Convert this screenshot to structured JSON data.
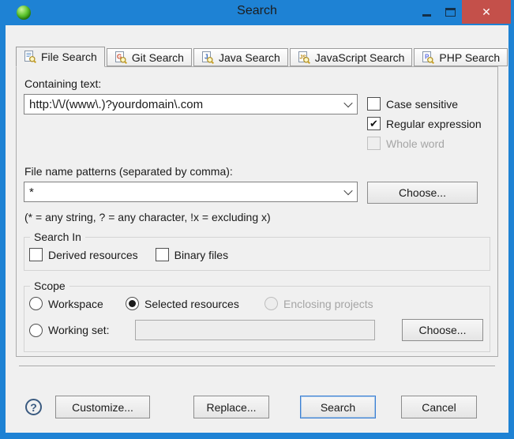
{
  "window": {
    "title": "Search",
    "icon": "app-icon-green-orb",
    "controls": {
      "minimize": "minimize-icon",
      "maximize": "maximize-icon",
      "close": "close-icon"
    }
  },
  "colors": {
    "titlebar_blue": "#1e82d4",
    "close_red": "#c4504a",
    "dialog_bg": "#f0f0f0",
    "default_button_border": "#3b7fd4"
  },
  "tabs": [
    {
      "label": "File Search",
      "glyph": "",
      "active": true
    },
    {
      "label": "Git Search",
      "glyph": "G",
      "active": false
    },
    {
      "label": "Java Search",
      "glyph": "J",
      "active": false
    },
    {
      "label": "JavaScript Search",
      "glyph": "JS",
      "active": false
    },
    {
      "label": "PHP Search",
      "glyph": "P",
      "active": false
    }
  ],
  "containing_text": {
    "label": "Containing text:",
    "value": "http:\\/\\/(www\\.)?yourdomain\\.com"
  },
  "options": {
    "case_sensitive": {
      "label": "Case sensitive",
      "checked": false,
      "enabled": true
    },
    "regular_expression": {
      "label": "Regular expression",
      "checked": true,
      "enabled": true
    },
    "whole_word": {
      "label": "Whole word",
      "checked": false,
      "enabled": false
    }
  },
  "file_patterns": {
    "label": "File name patterns (separated by comma):",
    "value": "*",
    "choose_label": "Choose...",
    "hint": "(* = any string, ? = any character, !x = excluding x)"
  },
  "search_in": {
    "legend": "Search In",
    "derived": {
      "label": "Derived resources",
      "checked": false
    },
    "binary": {
      "label": "Binary files",
      "checked": false
    }
  },
  "scope": {
    "legend": "Scope",
    "workspace": {
      "label": "Workspace",
      "selected": false,
      "enabled": true
    },
    "selected_resources": {
      "label": "Selected resources",
      "selected": true,
      "enabled": true
    },
    "enclosing_projects": {
      "label": "Enclosing projects",
      "selected": false,
      "enabled": false
    },
    "working_set": {
      "label": "Working set:",
      "selected": false,
      "value": "",
      "choose_label": "Choose..."
    }
  },
  "footer": {
    "help_glyph": "?",
    "customize_label": "Customize...",
    "replace_label": "Replace...",
    "search_label": "Search",
    "cancel_label": "Cancel"
  }
}
